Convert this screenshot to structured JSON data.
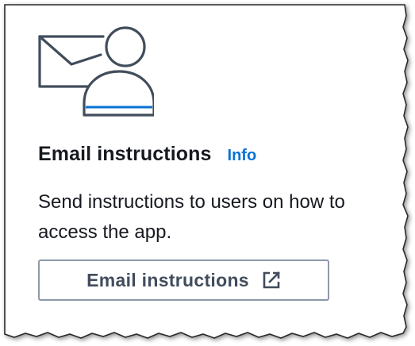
{
  "card": {
    "illustration_icon": "email-user-icon",
    "title": "Email instructions",
    "info_link": "Info",
    "description": "Send instructions to users on how to access the app.",
    "button": {
      "label": "Email instructions",
      "icon": "external-link-icon"
    }
  },
  "colors": {
    "text": "#16191f",
    "link": "#0972d3",
    "button_text": "#414d5c",
    "button_border": "#8d99a8",
    "illustration_stroke": "#414d5c",
    "illustration_accent": "#0972d3"
  }
}
